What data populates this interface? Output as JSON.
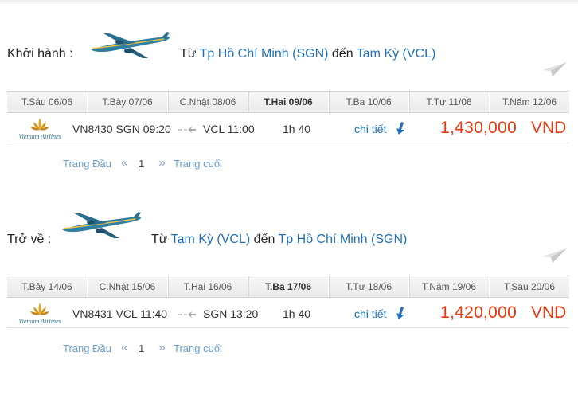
{
  "colors": {
    "link": "#1e6fb8",
    "price": "#e8380d",
    "pager": "#6a9fcf"
  },
  "outbound": {
    "lead": "Khởi hành :",
    "route": {
      "from_word": "Từ",
      "from_city": "Tp Hồ Chí Minh (SGN)",
      "to_word": "đến",
      "to_city": "Tam Kỳ (VCL)"
    },
    "dates": [
      {
        "label": "T.Sáu 06/06",
        "active": false
      },
      {
        "label": "T.Bảy 07/06",
        "active": false
      },
      {
        "label": "C.Nhật 08/06",
        "active": false
      },
      {
        "label": "T.Hai 09/06",
        "active": true
      },
      {
        "label": "T.Ba 10/06",
        "active": false
      },
      {
        "label": "T.Tư 11/06",
        "active": false
      },
      {
        "label": "T.Năm 12/06",
        "active": false
      }
    ],
    "flight": {
      "airline": "Vietnam Airlines",
      "departure": "VN8430 SGN 09:20",
      "arrival": "VCL 11:00",
      "duration": "1h 40",
      "detail": "chi tiết",
      "price": "1,430,000",
      "currency": "VND"
    },
    "pager": {
      "first": "Trang Đầu",
      "prev": "«",
      "page": "1",
      "next": "»",
      "last": "Trang cuối"
    }
  },
  "return": {
    "lead": "Trở về :",
    "route": {
      "from_word": "Từ",
      "from_city": "Tam Kỳ (VCL)",
      "to_word": "đến",
      "to_city": "Tp Hồ Chí Minh (SGN)"
    },
    "dates": [
      {
        "label": "T.Bảy 14/06",
        "active": false
      },
      {
        "label": "C.Nhật 15/06",
        "active": false
      },
      {
        "label": "T.Hai 16/06",
        "active": false
      },
      {
        "label": "T.Ba 17/06",
        "active": true
      },
      {
        "label": "T.Tư 18/06",
        "active": false
      },
      {
        "label": "T.Năm 19/06",
        "active": false
      },
      {
        "label": "T.Sáu 20/06",
        "active": false
      }
    ],
    "flight": {
      "airline": "Vietnam Airlines",
      "departure": "VN8431 VCL 11:40",
      "arrival": "SGN 13:20",
      "duration": "1h 40",
      "detail": "chi tiết",
      "price": "1,420,000",
      "currency": "VND"
    },
    "pager": {
      "first": "Trang Đầu",
      "prev": "«",
      "page": "1",
      "next": "»",
      "last": "Trang cuối"
    }
  },
  "icons": {
    "plane": "airplane-icon",
    "paper_plane": "paper-plane-icon",
    "arrow": "flight-arrow-icon",
    "detail_arrow": "arrow-down-icon",
    "logo": "vietnam-airlines-lotus-icon"
  }
}
